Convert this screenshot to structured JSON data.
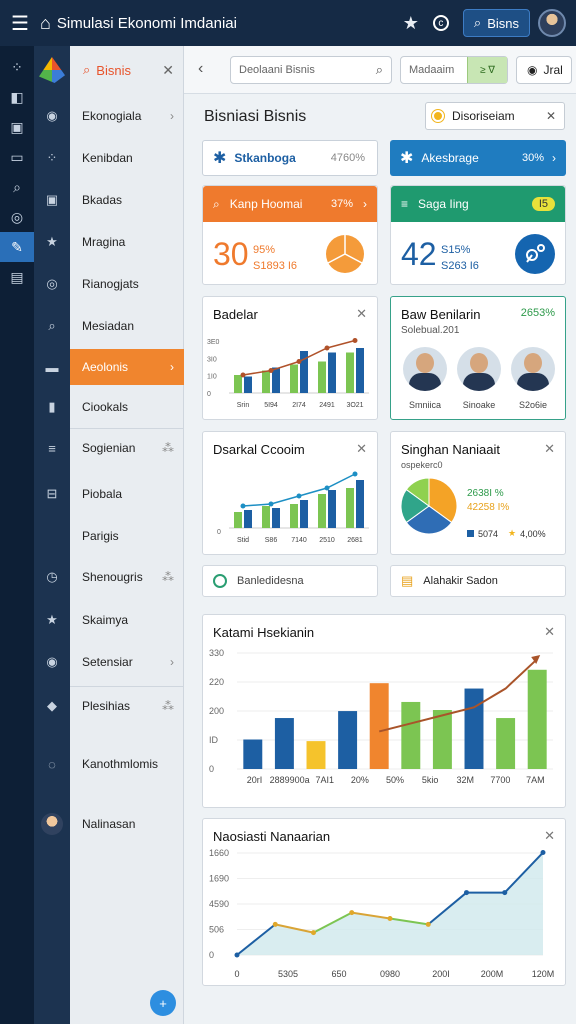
{
  "app": {
    "title": "Simulasi Ekonomi  Imdaniai",
    "top_button": "Bisns"
  },
  "rail": [
    "⁘",
    "◧",
    "▣",
    "▭",
    "⌕",
    "◎",
    "✎",
    "▤"
  ],
  "sidebar": {
    "search_label": "Bisnis",
    "items": [
      {
        "label": "Ekonogiala",
        "chev": "›"
      },
      {
        "label": "Kenibdan",
        "chev": ""
      },
      {
        "label": "Bkadas",
        "chev": ""
      },
      {
        "label": "Mragina",
        "chev": ""
      },
      {
        "label": "Rianogjats",
        "chev": ""
      },
      {
        "label": "Mesiadan",
        "chev": ""
      },
      {
        "label": "Aeolonis",
        "chev": "›"
      },
      {
        "label": "Ciookals",
        "chev": ""
      },
      {
        "label": "Sogienian",
        "chev": "⁂"
      },
      {
        "label": "Piobala",
        "chev": ""
      },
      {
        "label": "Parigis",
        "chev": ""
      },
      {
        "label": "Shenougris",
        "chev": "⁂"
      },
      {
        "label": "Skaimya",
        "chev": ""
      },
      {
        "label": "Setensiar",
        "chev": "›"
      },
      {
        "label": "Plesihias",
        "chev": "⁂"
      },
      {
        "label": "Kanothmlomis",
        "chev": ""
      },
      {
        "label": "Nalinasan",
        "chev": ""
      }
    ]
  },
  "toolbar": {
    "search_placeholder": "Deolaani Bisnis",
    "filter_label": "Madaaim",
    "filter_chip": "≥ ∇",
    "right_btn": "Jral"
  },
  "page": {
    "title": "Bisniasi Bisnis",
    "dropdown": "Disoriseiam"
  },
  "pills": [
    {
      "label": "Stkanboga",
      "value": "4760%"
    },
    {
      "label": "Akesbrage",
      "value": "30%"
    }
  ],
  "kpis": [
    {
      "header": "Kanp Hoomai",
      "pct": "37%",
      "num": "30",
      "l1": "95%",
      "l2": "S1893 I6"
    },
    {
      "header": "Saga Iing",
      "pct": "I5",
      "num": "42",
      "l1": "S15%",
      "l2": "S263 I6"
    }
  ],
  "badelar": {
    "title": "Badelar",
    "y_ticks": [
      "3E0",
      "3I0",
      "1I0",
      "0"
    ],
    "x": [
      "Srin",
      "5I94",
      "2I74",
      "2491",
      "3O21"
    ]
  },
  "people": {
    "title": "Baw Benilarin",
    "value": "2653%",
    "subtitle": "Solebual.201",
    "names": [
      "Smniica",
      "Sinoake",
      "S2o6ie"
    ]
  },
  "dsarkal": {
    "title": "Dsarkal Ccooim",
    "y0": "0",
    "x": [
      "Stid",
      "S86",
      "7140",
      "2510",
      "2681"
    ]
  },
  "pie": {
    "title": "Singhan Naniaait",
    "subtitle": "ospekerc0",
    "l1": "2638I %",
    "l2": "42258 I%",
    "leg1": "5074",
    "leg2": "4,00%"
  },
  "actions": [
    {
      "label": "Banledidesna"
    },
    {
      "label": "Alahakir Sadon"
    }
  ],
  "chart_data": [
    {
      "type": "bar",
      "title": "Badelar",
      "categories": [
        "Srin",
        "5I94",
        "2I74",
        "2491",
        "3O21"
      ],
      "series": [
        {
          "values": [
            11,
            17,
            28,
            27,
            30
          ]
        },
        {
          "values": [
            12,
            15,
            19,
            21,
            27
          ]
        }
      ],
      "line": [
        12,
        15,
        21,
        30,
        35
      ],
      "ylim": [
        0,
        40
      ]
    },
    {
      "type": "bar",
      "title": "Dsarkal Ccooim",
      "categories": [
        "Stid",
        "S86",
        "7140",
        "2510",
        "2681"
      ],
      "series": [
        {
          "values": [
            9,
            10,
            14,
            19,
            24
          ]
        },
        {
          "values": [
            8,
            11,
            12,
            17,
            20
          ]
        }
      ],
      "line": [
        11,
        12,
        16,
        20,
        27
      ],
      "ylim": [
        0,
        30
      ]
    },
    {
      "type": "pie",
      "title": "Singhan Naniaait",
      "values": [
        35,
        30,
        20,
        15
      ],
      "colors": [
        "#f4a326",
        "#2f6db5",
        "#30a58a",
        "#8fd14f"
      ]
    },
    {
      "type": "bar",
      "title": "Katami Hsekianin",
      "y_ticks": [
        "330",
        "220",
        "200",
        "ID",
        "0"
      ],
      "x_ticks": [
        "20rI",
        "2889900a",
        "7AI1",
        "20%",
        "50%",
        "5kio",
        "32M",
        "7700",
        "7AM"
      ],
      "values": [
        55,
        95,
        52,
        108,
        160,
        125,
        110,
        150,
        95,
        185
      ],
      "colors": [
        "#1d5fa3",
        "#1d5fa3",
        "#f5c32c",
        "#1d5fa3",
        "#f0852e",
        "#7cc552",
        "#7cc552",
        "#1d5fa3",
        "#7cc552",
        "#7cc552"
      ],
      "line": [
        10,
        25,
        40,
        55,
        70,
        85,
        100,
        115,
        150,
        205
      ],
      "ylim": [
        0,
        220
      ]
    },
    {
      "type": "area",
      "title": "Naosiasti Nanaarian",
      "y_ticks": [
        "1660",
        "1690",
        "4590",
        "506",
        "0"
      ],
      "x_ticks": [
        "0",
        "5305",
        "650",
        "0980",
        "200I",
        "200M",
        "120M"
      ],
      "values": [
        0,
        520,
        380,
        720,
        620,
        520,
        1060,
        1060,
        1740
      ],
      "ylim": [
        0,
        1800
      ]
    }
  ]
}
